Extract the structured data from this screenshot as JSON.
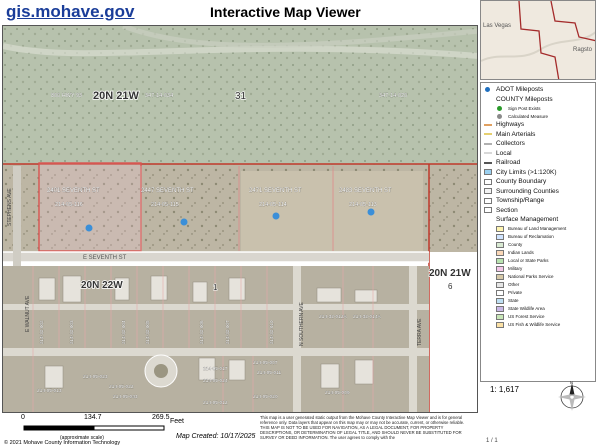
{
  "header": {
    "site_link": "gis.mohave.gov",
    "title": "Interactive Map Viewer"
  },
  "map": {
    "township_labels": [
      "20N 21W",
      "20N 22W",
      "20N 21W"
    ],
    "section_label": "31",
    "top_parcel_labels": [
      "800 HWY 93",
      "347-14-034",
      "347-14-020"
    ],
    "parcels": [
      {
        "address": "2401 SEVENTH ST",
        "apn": "214-05-116"
      },
      {
        "address": "2447 SEVENTH ST",
        "apn": "214-05-115"
      },
      {
        "address": "2471 SEVENTH ST",
        "apn": "214-05-114"
      },
      {
        "address": "2483 SEVENTH ST",
        "apn": "214-05-113"
      }
    ],
    "street_labels": [
      "E SEVENTH ST",
      "STEPHENS AVE",
      "E WALNUT AVE",
      "N SOUTHERN AVE",
      "TERRA AVE"
    ],
    "lower_parcel_labels": [
      "214-32-002",
      "214-32-003",
      "214-32-004",
      "214-32-005",
      "214-32-006",
      "214-32-007",
      "214-32-010",
      "214-32-012A",
      "214-32-014A",
      "214-05-007",
      "214-05-011",
      "214-05-017",
      "214-05-024",
      "214-05-020",
      "214-05-023",
      "214-05-022",
      "214-05-043",
      "214-05-013",
      "214-05-009",
      "214-05-012"
    ],
    "section_number_small": "1",
    "parcel_number_small": "6"
  },
  "inset": {
    "place_labels": [
      "Las Vegas",
      "Ragsto"
    ]
  },
  "legend": {
    "items": [
      {
        "label": "ADOT Mileposts",
        "kind": "dot",
        "color": "#1f6fbf",
        "sub": false
      },
      {
        "label": "COUNTY Mileposts",
        "kind": "none",
        "color": "#ffffff",
        "sub": false
      },
      {
        "label": "Sign Post Exists",
        "kind": "dot",
        "color": "#2a9a2a",
        "sub": true
      },
      {
        "label": "Calculated Measure",
        "kind": "dot",
        "color": "#8a8a8a",
        "sub": true
      },
      {
        "label": "Highways",
        "kind": "line",
        "color": "#e0a060",
        "sub": false
      },
      {
        "label": "Main Arterials",
        "kind": "line",
        "color": "#e6d070",
        "sub": false
      },
      {
        "label": "Collectors",
        "kind": "line",
        "color": "#b0b0b0",
        "sub": false
      },
      {
        "label": "Local",
        "kind": "line",
        "color": "#d8d8d8",
        "sub": false
      },
      {
        "label": "Railroad",
        "kind": "line",
        "color": "#555555",
        "sub": false
      },
      {
        "label": "City Limits (>1:120K)",
        "kind": "box",
        "color": "#9ad0f0",
        "sub": false
      },
      {
        "label": "County Boundary",
        "kind": "box",
        "color": "#ffffff",
        "sub": false
      },
      {
        "label": "Surrounding Counties",
        "kind": "box",
        "color": "#f4f4f4",
        "sub": false
      },
      {
        "label": "Township/Range",
        "kind": "box",
        "color": "#ffffff",
        "sub": false
      },
      {
        "label": "Section",
        "kind": "box",
        "color": "#ffffff",
        "sub": false
      },
      {
        "label": "Surface Management",
        "kind": "none",
        "color": "#ffffff",
        "sub": false
      },
      {
        "label": "Bureau of Land Management",
        "kind": "box",
        "color": "#fef4b0",
        "sub": true
      },
      {
        "label": "Bureau of Reclamation",
        "kind": "box",
        "color": "#d0e4ff",
        "sub": true
      },
      {
        "label": "County",
        "kind": "box",
        "color": "#d9ead3",
        "sub": true
      },
      {
        "label": "Indian Lands",
        "kind": "box",
        "color": "#fbd8b8",
        "sub": true
      },
      {
        "label": "Local or State Parks",
        "kind": "box",
        "color": "#b9e3b0",
        "sub": true
      },
      {
        "label": "Military",
        "kind": "box",
        "color": "#f3c6e8",
        "sub": true
      },
      {
        "label": "National Parks Service",
        "kind": "box",
        "color": "#d6c9a8",
        "sub": true
      },
      {
        "label": "Other",
        "kind": "box",
        "color": "#e6e6e6",
        "sub": true
      },
      {
        "label": "Private",
        "kind": "box",
        "color": "#ffffff",
        "sub": true
      },
      {
        "label": "State",
        "kind": "box",
        "color": "#bfe0f4",
        "sub": true
      },
      {
        "label": "State Wildlife Area",
        "kind": "box",
        "color": "#c9b7e6",
        "sub": true
      },
      {
        "label": "US Forest Service",
        "kind": "box",
        "color": "#c8e6b8",
        "sub": true
      },
      {
        "label": "US Fish & Wildlife Service",
        "kind": "box",
        "color": "#fbe1a6",
        "sub": true
      }
    ]
  },
  "footer": {
    "scale_ratio": "1: 1,617",
    "scale_ticks": [
      "0",
      "134.7",
      "269.5"
    ],
    "scale_units": "Feet",
    "scale_note": "(approximate scale)",
    "copyright": "© 2021 Mohave County Information Technology",
    "map_created": "Map Created: 10/17/2025",
    "disclaimer": "This map is a user generated static output from the Mohave County Interactive Map Viewer and is for general reference only. Data layers that appear on this map may or may not be accurate, current, or otherwise reliable. THIS MAP IS NOT TO BE USED FOR NAVIGATION, AS A LEGAL DOCUMENT, FOR PROPERTY DESCRIPTIONS, OR DETERMINATION OF LEGAL TITLE, AND SHOULD NEVER BE SUBSTITUTED FOR SURVEY OR DEED INFORMATION. The user agrees to comply with the",
    "page_number": "1 / 1"
  },
  "colors": {
    "parcel_outline": "#d9534f",
    "selected_parcel": "#f4c6d6",
    "milepost": "#3b8fd8",
    "section_line": "#c0392b"
  }
}
